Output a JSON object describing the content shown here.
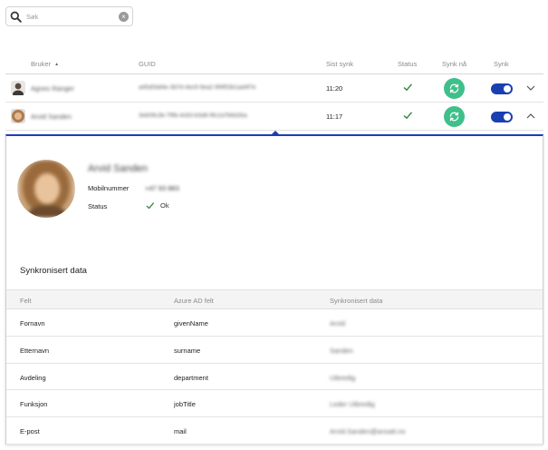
{
  "search": {
    "placeholder": "Søk"
  },
  "table": {
    "headers": {
      "user": "Bruker",
      "guid": "GUID",
      "last_sync": "Sist synk",
      "status": "Status",
      "sync_now": "Synk nå",
      "sync": "Synk"
    },
    "rows": [
      {
        "name": "Agnes Ranger",
        "guid": "a45d0dd4e-3b7d-4ec9-9ea2-9f4f53b1ad4f7e",
        "last_sync": "11:20",
        "status": "ok",
        "sync_enabled": true,
        "expanded": false
      },
      {
        "name": "Arvid Sanden",
        "guid": "3eb09c3b-7f9b-4c63-b3d8-9fc2a7b6d2ba",
        "last_sync": "11:17",
        "status": "ok",
        "sync_enabled": true,
        "expanded": true
      }
    ]
  },
  "detail": {
    "name": "Arvid Sanden",
    "mobile_label": "Mobilnummer",
    "mobile_value": "+47 93 883",
    "status_label": "Status",
    "status_value": "Ok",
    "section_title": "Synkronisert data",
    "columns": {
      "field": "Felt",
      "azure": "Azure AD felt",
      "synced": "Synkronisert data"
    },
    "rows": [
      {
        "field": "Fornavn",
        "azure": "givenName",
        "value": "Arvid"
      },
      {
        "field": "Etternavn",
        "azure": "surname",
        "value": "Sanden"
      },
      {
        "field": "Avdeling",
        "azure": "department",
        "value": "Utbredig"
      },
      {
        "field": "Funksjon",
        "azure": "jobTitle",
        "value": "Leder Utbredig"
      },
      {
        "field": "E-post",
        "azure": "mail",
        "value": "Arvid.Sanden@ansatt.no"
      }
    ]
  },
  "colors": {
    "accent": "#1a3fb3",
    "sync_button": "#3fbf8a",
    "ok_check": "#2f8a3a"
  },
  "icons": {
    "search": "search-icon",
    "clear": "clear-icon",
    "sort": "sort-asc-icon",
    "check": "check-icon",
    "refresh": "refresh-icon",
    "chevron_down": "chevron-down-icon",
    "chevron_up": "chevron-up-icon"
  }
}
